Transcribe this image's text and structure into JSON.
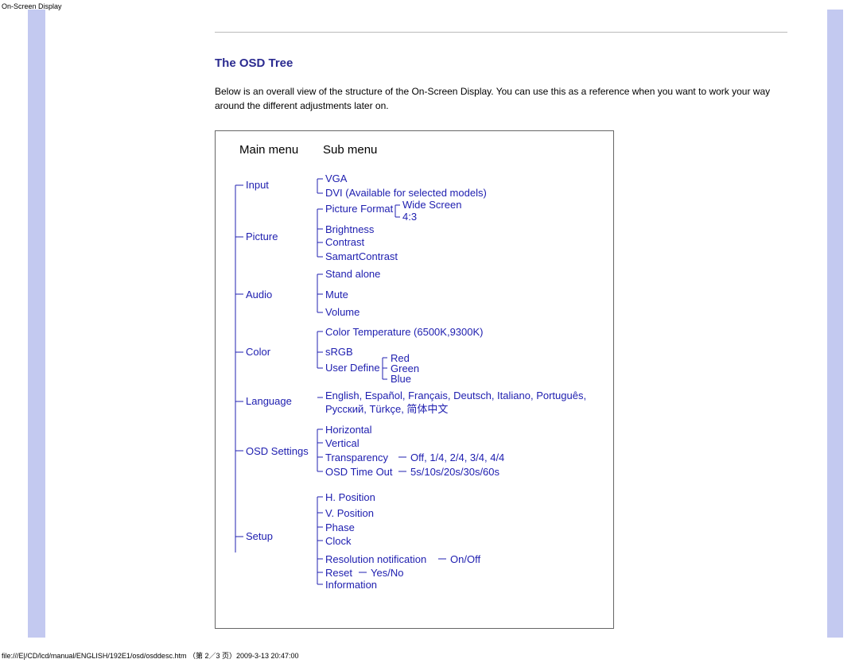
{
  "meta": {
    "header": "On-Screen Display",
    "footer": "file:///E|/CD/lcd/manual/ENGLISH/192E1/osd/osddesc.htm （第 2／3 页）2009-3-13 20:47:00"
  },
  "page": {
    "heading": "The OSD Tree",
    "intro": "Below is an overall view of the structure of the On-Screen Display. You can use this as a reference when you want to work your way around the different adjustments later on."
  },
  "tree": {
    "col_main": "Main menu",
    "col_sub": "Sub menu",
    "main": [
      "Input",
      "Picture",
      "Audio",
      "Color",
      "Language",
      "OSD Settings",
      "Setup"
    ],
    "input": [
      "VGA",
      "DVI (Available for selected models)"
    ],
    "picture": [
      "Picture Format",
      "Brightness",
      "Contrast",
      "SamartContrast"
    ],
    "pictureFormat": [
      "Wide Screen",
      "4:3"
    ],
    "audio": [
      "Stand alone",
      "Mute",
      "Volume"
    ],
    "color": [
      "Color Temperature (6500K,9300K)",
      "sRGB",
      "User Define"
    ],
    "userDefine": [
      "Red",
      "Green",
      "Blue"
    ],
    "language": "English, Español, Français, Deutsch, Italiano, Português, Русский, Türkçe, 简体中文",
    "osd": [
      "Horizontal",
      "Vertical",
      "Transparency",
      "OSD Time Out"
    ],
    "osdTransparency": "Off, 1/4, 2/4, 3/4, 4/4",
    "osdTimeout": "5s/10s/20s/30s/60s",
    "setup": [
      "H. Position",
      "V. Position",
      "Phase",
      "Clock",
      "Resolution notification",
      "Reset",
      "Information"
    ],
    "resNotif": "On/Off",
    "resetOpt": "Yes/No"
  }
}
